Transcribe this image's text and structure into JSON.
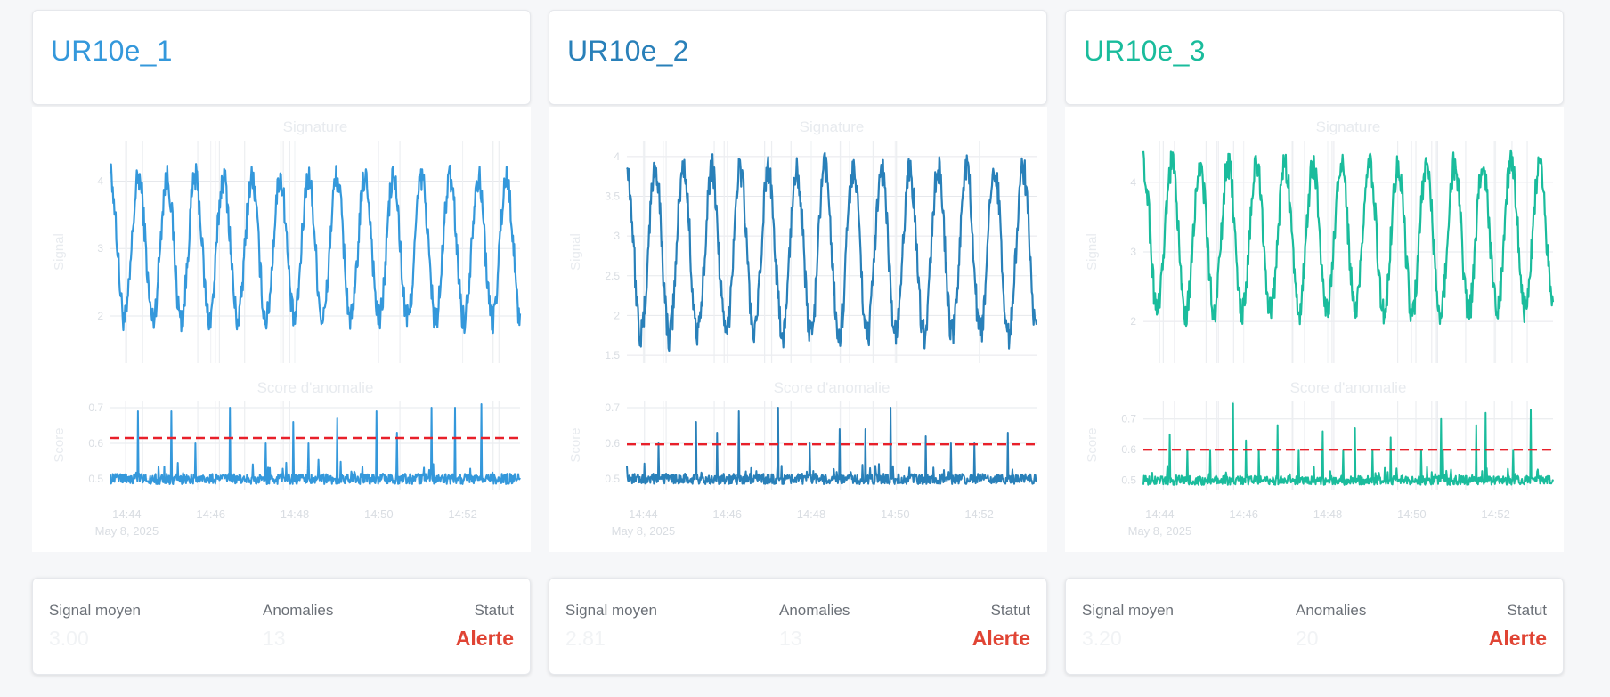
{
  "colors": {
    "threshold": "#e8202a",
    "alert": "#e04434",
    "muted": "#e8ebef",
    "grid": "#e6e8ec"
  },
  "common": {
    "signal_chart_title": "Signature",
    "signal_ylabel": "Signal",
    "score_chart_title": "Score d'anomalie",
    "score_ylabel": "Score",
    "x_tick_labels": [
      "14:44",
      "14:46",
      "14:48",
      "14:50",
      "14:52"
    ],
    "x_date_label": "May 8, 2025",
    "stat_labels": {
      "mean": "Signal moyen",
      "anomalies": "Anomalies",
      "status": "Statut"
    }
  },
  "robots": [
    {
      "name": "UR10e_1",
      "color": "#3498db",
      "mean_signal": "3.00",
      "anomalies": "13",
      "status": "Alerte"
    },
    {
      "name": "UR10e_2",
      "color": "#2980b9",
      "mean_signal": "2.81",
      "anomalies": "13",
      "status": "Alerte"
    },
    {
      "name": "UR10e_3",
      "color": "#1abc9c",
      "mean_signal": "3.20",
      "anomalies": "20",
      "status": "Alerte"
    }
  ],
  "chart_data": [
    {
      "type": "line",
      "title": "Signature",
      "ylabel": "Signal",
      "series": [
        {
          "name": "UR10e_1",
          "color": "#3498db",
          "periods": 14.5,
          "mid": 3.0,
          "amp": 1.05,
          "noise": 0.22
        }
      ],
      "y_ticks": [
        2,
        3,
        4
      ],
      "ylim": [
        1.3,
        4.6
      ],
      "x_range": [
        "14:43:45",
        "14:53:30"
      ],
      "anomaly_markers": 13
    },
    {
      "type": "line",
      "title": "Score d'anomalie",
      "ylabel": "Score",
      "series": [
        {
          "name": "UR10e_1",
          "color": "#3498db",
          "baseline": 0.5
        }
      ],
      "threshold": 0.615,
      "y_ticks": [
        0.5,
        0.6,
        0.7
      ],
      "ylim": [
        0.47,
        0.72
      ],
      "anomaly_peaks": [
        0.69,
        0.69,
        0.6,
        0.7,
        0.6,
        0.66,
        0.6,
        0.67,
        0.69,
        0.63,
        0.7,
        0.7,
        0.71
      ]
    },
    {
      "type": "line",
      "title": "Signature",
      "ylabel": "Signal",
      "series": [
        {
          "name": "UR10e_2",
          "color": "#2980b9",
          "periods": 14.5,
          "mid": 2.8,
          "amp": 1.05,
          "noise": 0.2
        }
      ],
      "y_ticks": [
        1.5,
        2,
        2.5,
        3,
        3.5,
        4
      ],
      "ylim": [
        1.4,
        4.2
      ],
      "x_range": [
        "14:43:45",
        "14:53:30"
      ],
      "anomaly_markers": 13
    },
    {
      "type": "line",
      "title": "Score d'anomalie",
      "ylabel": "Score",
      "series": [
        {
          "name": "UR10e_2",
          "color": "#2980b9",
          "baseline": 0.5
        }
      ],
      "threshold": 0.597,
      "y_ticks": [
        0.5,
        0.6,
        0.7
      ],
      "ylim": [
        0.47,
        0.72
      ],
      "anomaly_peaks": [
        0.6,
        0.66,
        0.63,
        0.69,
        0.7,
        0.6,
        0.64,
        0.64,
        0.7,
        0.62,
        0.6,
        0.6,
        0.63
      ]
    },
    {
      "type": "line",
      "title": "Signature",
      "ylabel": "Signal",
      "series": [
        {
          "name": "UR10e_3",
          "color": "#1abc9c",
          "periods": 14.5,
          "mid": 3.2,
          "amp": 1.05,
          "noise": 0.22
        }
      ],
      "y_ticks": [
        2,
        3,
        4
      ],
      "ylim": [
        1.4,
        4.6
      ],
      "x_range": [
        "14:43:45",
        "14:53:30"
      ],
      "anomaly_markers": 20
    },
    {
      "type": "line",
      "title": "Score d'anomalie",
      "ylabel": "Score",
      "series": [
        {
          "name": "UR10e_3",
          "color": "#1abc9c",
          "baseline": 0.5
        }
      ],
      "threshold": 0.6,
      "y_ticks": [
        0.5,
        0.6,
        0.7
      ],
      "ylim": [
        0.47,
        0.76
      ],
      "anomaly_peaks": [
        0.65,
        0.6,
        0.6,
        0.75,
        0.63,
        0.6,
        0.68,
        0.6,
        0.66,
        0.6,
        0.67,
        0.6,
        0.64,
        0.6,
        0.7,
        0.6,
        0.68,
        0.72,
        0.6,
        0.73
      ]
    }
  ]
}
